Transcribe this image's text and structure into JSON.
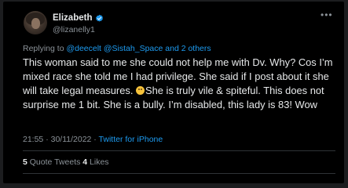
{
  "author": {
    "name": "Elizabeth",
    "handle": "@lizanelly1",
    "verified_color": "#1d9bf0"
  },
  "reply": {
    "prefix": "Replying to ",
    "mentions": "@deecelt @Sistah_Space and 2 others"
  },
  "tweet": {
    "text_part1": "This woman said to me she could not help me with Dv. Why? Cos I’m mixed race she told me I had privilege. She said if I post about it she will take legal measures. ",
    "emoji": "grinning-face-sweat-emoji",
    "text_part2": "She is truly vile & spiteful. This does not surprise  me 1 bit. She is a bully. I’m disabled, this lady is 83! Wow"
  },
  "meta": {
    "timestamp": "21:55 · 30/11/2022 · ",
    "source": "Twitter for iPhone"
  },
  "stats": {
    "quote_count": "5",
    "quote_label": " Quote Tweets  ",
    "like_count": "4",
    "like_label": " Likes"
  },
  "icons": {
    "more": "more-options-icon",
    "verified": "verified-badge-icon"
  }
}
